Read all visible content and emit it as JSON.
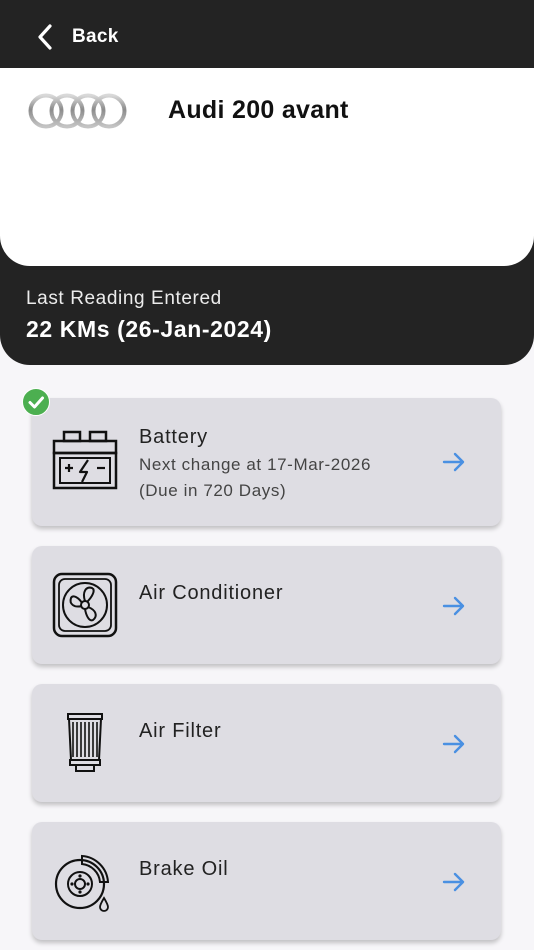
{
  "nav": {
    "back_label": "Back"
  },
  "car": {
    "name": "Audi 200 avant",
    "logo_icon": "audi-rings-logo"
  },
  "reading": {
    "label": "Last Reading Entered",
    "value": "22 KMs (26-Jan-2024)"
  },
  "services": [
    {
      "title": "Battery",
      "icon": "car-battery-icon",
      "completed": true,
      "next_change": "Next change at 17-Mar-2026",
      "due": "(Due in 720 Days)"
    },
    {
      "title": "Air Conditioner",
      "icon": "fan-icon",
      "completed": false
    },
    {
      "title": "Air Filter",
      "icon": "air-filter-icon",
      "completed": false
    },
    {
      "title": "Brake Oil",
      "icon": "brake-disc-icon",
      "completed": false
    }
  ],
  "colors": {
    "header_bg": "#232323",
    "card_bg": "#dedde3",
    "accent_arrow": "#4a90e2",
    "check_green": "#4caf50"
  }
}
